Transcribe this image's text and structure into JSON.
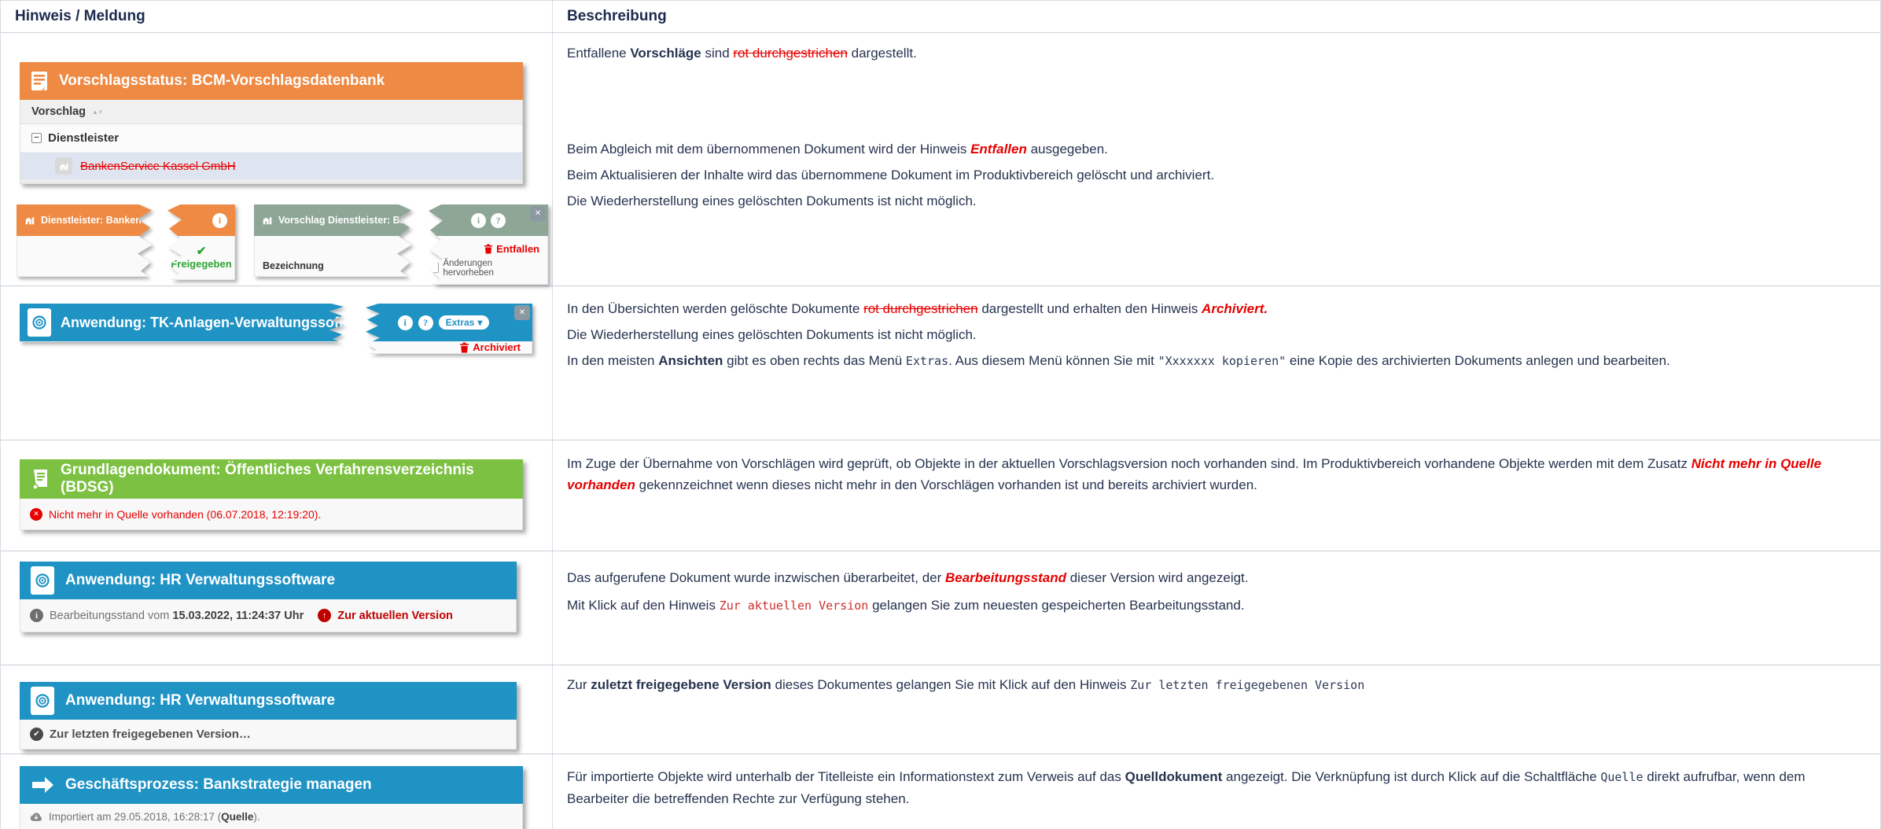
{
  "colors": {
    "orange": "#ee8a43",
    "blue": "#2093c5",
    "green": "#7cc142",
    "sage": "#8ea696",
    "red": "#e60000",
    "navy": "#1d2b4e",
    "link_red": "#c00000"
  },
  "icons": {
    "info": "i",
    "help": "?",
    "close": "✕",
    "check": "✔",
    "caret_down": "▾",
    "sort_up": "▲",
    "sort_down": "▼",
    "collapse": "−",
    "up_arrow": "↑"
  },
  "table": {
    "col1": "Hinweis / Meldung",
    "col2": "Beschreibung"
  },
  "rows": [
    {
      "proposal_widget": {
        "title": "Vorschlagsstatus: BCM-Vorschlagsdatenbank",
        "column": "Vorschlag",
        "group": "Dienstleister",
        "item": "BankenService Kassel GmbH"
      },
      "compare_cards": {
        "left_title": "Dienstleister: BankenServic",
        "left_status": "Freigegeben",
        "right_title": "Vorschlag Dienstleister: BankenS",
        "right_field": "Bezeichnung",
        "right_status": "Entfallen",
        "right_checkbox": "Änderungen hervorheben"
      },
      "desc": [
        [
          {
            "t": "Entfallene "
          },
          {
            "t": "Vorschläge",
            "c": "b"
          },
          {
            "t": " sind "
          },
          {
            "t": "rot durchgestrichen",
            "c": "strike"
          },
          {
            "t": " dargestellt."
          }
        ],
        [
          {
            "t": "Beim Abgleich mit dem übernommenen Dokument wird der Hinweis "
          },
          {
            "t": "Entfallen",
            "c": "redi"
          },
          {
            "t": " ausgegeben."
          }
        ],
        [
          {
            "t": "Beim Aktualisieren der Inhalte wird das übernommene Dokument im Produktivbereich gelöscht und archiviert."
          }
        ],
        [
          {
            "t": "Die Wiederherstellung eines gelöschten Dokuments ist nicht möglich."
          }
        ]
      ]
    },
    {
      "card": {
        "title": "Anwendung: TK-Anlagen-Verwaltungssoftware",
        "extras": "Extras",
        "status": "Archiviert"
      },
      "desc": [
        [
          {
            "t": "In den Übersichten werden gelöschte Dokumente "
          },
          {
            "t": "rot durchgestrichen",
            "c": "strike"
          },
          {
            "t": " dargestellt und erhalten den Hinweis "
          },
          {
            "t": "Archiviert.",
            "c": "redi"
          }
        ],
        [
          {
            "t": "Die Wiederherstellung eines gelöschten Dokuments ist nicht möglich."
          }
        ],
        [
          {
            "t": "In den meisten "
          },
          {
            "t": "Ansichten",
            "c": "b"
          },
          {
            "t": " gibt es oben rechts das Menü "
          },
          {
            "t": "Extras",
            "c": "mono"
          },
          {
            "t": ". Aus diesem Menü können Sie mit "
          },
          {
            "t": "\"Xxxxxxx kopieren\"",
            "c": "mono"
          },
          {
            "t": " eine Kopie des archivierten Dokuments anlegen und bearbeiten."
          }
        ]
      ]
    },
    {
      "card": {
        "title": "Grundlagendokument: Öffentliches Verfahrensverzeichnis (BDSG)",
        "status": "Nicht mehr in Quelle vorhanden (06.07.2018, 12:19:20)."
      },
      "desc": [
        [
          {
            "t": "Im Zuge der Übernahme von Vorschlägen wird geprüft, ob Objekte in der aktuellen Vorschlagsversion noch vorhanden sind. Im Produktivbereich vorhandene Objekte werden mit dem Zusatz "
          },
          {
            "t": "Nicht mehr in Quelle vorhanden",
            "c": "redi"
          },
          {
            "t": " gekennzeichnet wenn dieses nicht mehr in den Vorschlägen vorhanden ist und bereits archiviert wurden."
          }
        ]
      ]
    },
    {
      "card": {
        "title": "Anwendung: HR Verwaltungssoftware",
        "meta": [
          {
            "t": "Bearbeitungsstand vom ",
            "c": "gray"
          },
          {
            "t": "15.03.2022, 11:24:37 Uhr",
            "c": "darkb"
          }
        ],
        "link": "Zur aktuellen Version"
      },
      "desc": [
        [
          {
            "t": "Das aufgerufene Dokument wurde inzwischen überarbeitet, der "
          },
          {
            "t": "Bearbeitungsstand",
            "c": "redi"
          },
          {
            "t": " dieser Version wird angezeigt."
          }
        ],
        [
          {
            "t": "Mit Klick auf den Hinweis "
          },
          {
            "t": "Zur aktuellen Version",
            "c": "monored"
          },
          {
            "t": " gelangen Sie zum neuesten gespeicherten Bearbeitungsstand."
          }
        ]
      ]
    },
    {
      "card": {
        "title": "Anwendung: HR Verwaltungssoftware",
        "link": "Zur letzten freigegebenen Version…"
      },
      "desc": [
        [
          {
            "t": "Zur "
          },
          {
            "t": "zuletzt freigegebene Version",
            "c": "b"
          },
          {
            "t": " dieses Dokumentes gelangen Sie mit Klick auf den Hinweis "
          },
          {
            "t": "Zur letzten freigegebenen Version",
            "c": "mono"
          }
        ]
      ]
    },
    {
      "card": {
        "title": "Geschäftsprozess: Bankstrategie managen",
        "meta": [
          {
            "t": "Importiert am 29.05.2018, 16:28:17 (",
            "c": "gray"
          },
          {
            "t": "Quelle",
            "c": "darkb"
          },
          {
            "t": ").",
            "c": "gray"
          }
        ]
      },
      "desc": [
        [
          {
            "t": "Für importierte Objekte wird unterhalb der Titelleiste ein Informationstext zum Verweis auf das "
          },
          {
            "t": "Quelldokument",
            "c": "b"
          },
          {
            "t": " angezeigt. Die Verknüpfung ist durch Klick auf die Schaltfläche "
          },
          {
            "t": "Quelle",
            "c": "mono"
          },
          {
            "t": "  direkt aufrufbar, wenn dem Bearbeiter die betreffenden Rechte zur Verfügung stehen."
          }
        ]
      ]
    }
  ]
}
